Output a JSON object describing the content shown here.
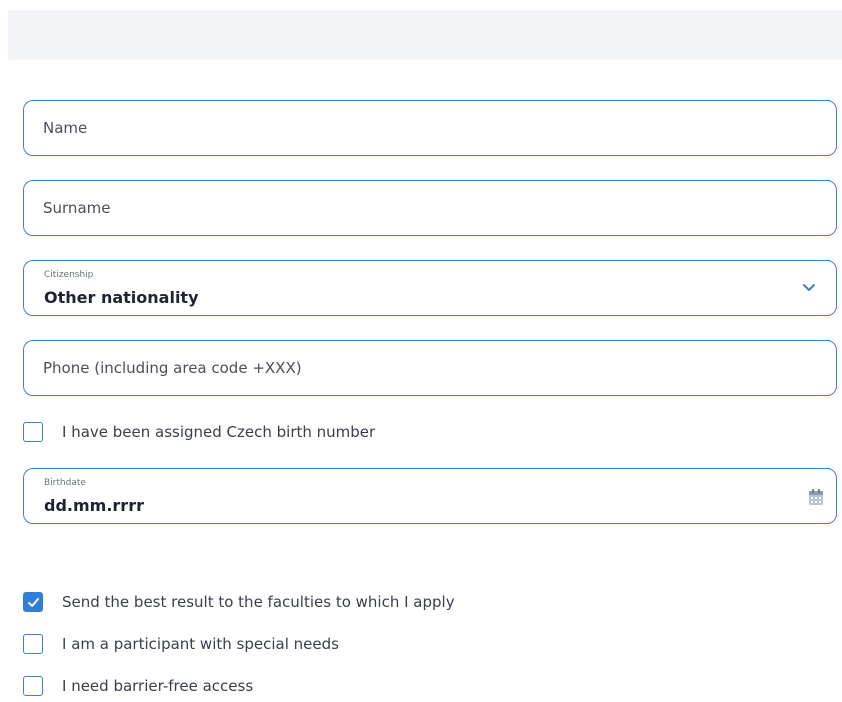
{
  "form": {
    "name": {
      "placeholder": "Name"
    },
    "surname": {
      "placeholder": "Surname"
    },
    "citizenship": {
      "label": "Citizenship",
      "value": "Other nationality"
    },
    "phone": {
      "placeholder": "Phone (including area code +XXX)"
    },
    "czech_birth_number": {
      "label": "I have been assigned Czech birth number",
      "checked": false
    },
    "birthdate": {
      "label": "Birthdate",
      "value": "dd.mm.rrrr"
    },
    "send_best_result": {
      "label": "Send the best result to the faculties to which I apply",
      "checked": true
    },
    "special_needs": {
      "label": "I am a participant with special needs",
      "checked": false
    },
    "barrier_free": {
      "label": "I need barrier-free access",
      "checked": false
    }
  },
  "colors": {
    "accent": "#3d7fd0",
    "checkbox_checked": "#2f7fd8",
    "header_band": "#f2f4f8"
  }
}
